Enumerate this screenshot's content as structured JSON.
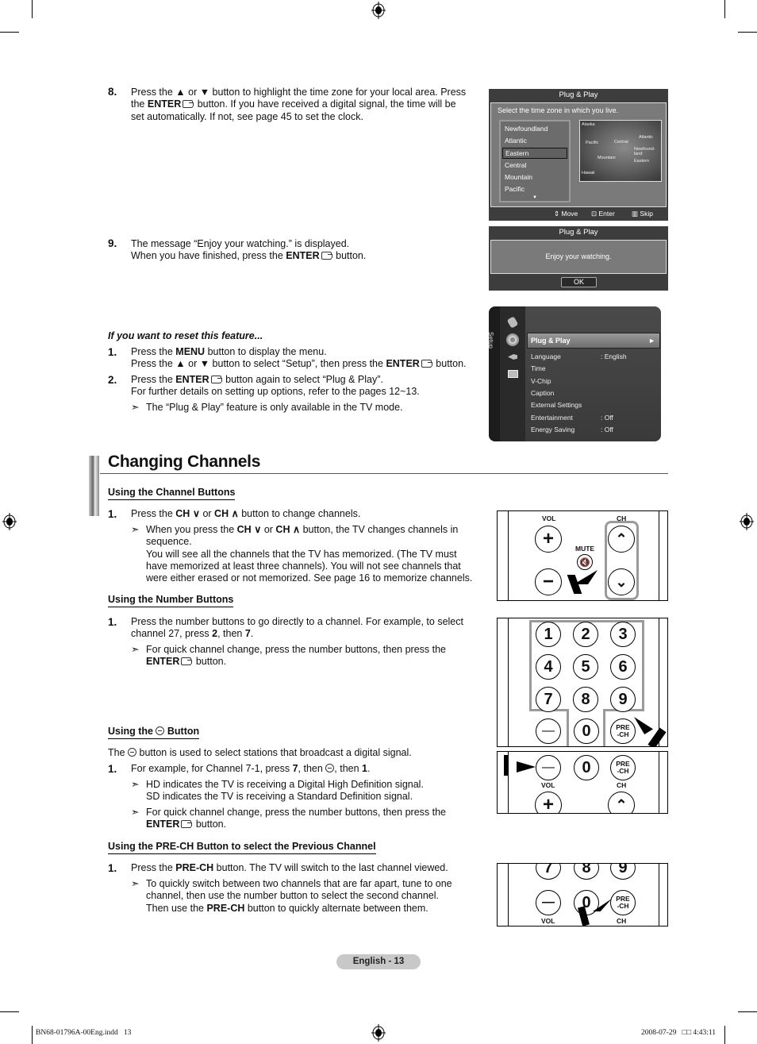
{
  "steps_top": {
    "s8": {
      "num": "8.",
      "line1": "Press the ▲ or ▼ button to highlight the time zone for your local area. Press",
      "line2a": "the ",
      "line2b": "ENTER",
      "line2c": " button. If you have received a digital signal, the time will be",
      "line3": "set automatically. If not, see page 45 to set the clock."
    },
    "s9": {
      "num": "9.",
      "line1": "The message “Enjoy your watching.” is displayed.",
      "line2a": "When you have finished, press the ",
      "line2b": "ENTER",
      "line2c": " button."
    }
  },
  "reset": {
    "heading": "If you want to reset this feature...",
    "s1": {
      "num": "1.",
      "l1a": "Press the ",
      "l1b": "MENU",
      "l1c": " button to display the menu.",
      "l2a": "Press the ▲ or ▼ button to select “Setup”, then press the ",
      "l2b": "ENTER",
      "l2c": " button."
    },
    "s2": {
      "num": "2.",
      "l1a": "Press the ",
      "l1b": "ENTER",
      "l1c": " button again to select “Plug & Play”.",
      "l2": "For further details on setting up options, refer to the pages 12~13."
    },
    "note": "The “Plug & Play” feature is only available in the TV mode."
  },
  "osd_timezone": {
    "title": "Plug & Play",
    "prompt": "Select the time zone in which you live.",
    "zones": [
      "Newfoundland",
      "Atlantic",
      "Eastern",
      "Central",
      "Mountain",
      "Pacific"
    ],
    "selected": "Eastern",
    "map_labels": [
      "Alaska",
      "Pacific",
      "Central",
      "Atlantic",
      "Newfound-land",
      "Mountain",
      "Eastern",
      "Hawaii"
    ],
    "footer": {
      "move": "Move",
      "enter": "Enter",
      "skip": "Skip"
    }
  },
  "osd_enjoy": {
    "title": "Plug & Play",
    "message": "Enjoy your watching.",
    "ok": "OK"
  },
  "osd_setup": {
    "side_label": "Setup",
    "selected": "Plug & Play",
    "items": [
      {
        "label": "Language",
        "value": ": English"
      },
      {
        "label": "Time",
        "value": ""
      },
      {
        "label": "V-Chip",
        "value": ""
      },
      {
        "label": "Caption",
        "value": ""
      },
      {
        "label": "External Settings",
        "value": ""
      },
      {
        "label": "Entertainment",
        "value": ": Off"
      },
      {
        "label": "Energy Saving",
        "value": ": Off"
      }
    ]
  },
  "section": {
    "title": "Changing Channels",
    "channel_buttons": {
      "heading": "Using the Channel Buttons",
      "s1": {
        "num": "1.",
        "a": "Press the ",
        "b": "CH",
        "c": " or ",
        "d": "CH",
        "e": " button to change channels."
      },
      "note_a": "When you press the ",
      "note_b": "CH",
      "note_c": " or ",
      "note_d": "CH",
      "note_e": " button, the TV changes channels in",
      "note_l2": "sequence.",
      "note_l3": "You will see all the channels that the TV has memorized. (The TV must",
      "note_l4": "have memorized at least three channels). You will not see channels that",
      "note_l5": "were either erased or not memorized. See page 16 to memorize channels."
    },
    "number_buttons": {
      "heading": "Using the Number Buttons",
      "s1": {
        "num": "1.",
        "l1": "Press the number buttons to go directly to a channel. For example, to select",
        "l2a": "channel 27, press ",
        "l2b": "2",
        "l2c": ", then ",
        "l2d": "7",
        "l2e": "."
      },
      "note_l1": "For quick channel change, press the number buttons, then press the",
      "note_l2a": "ENTER",
      "note_l2b": " button."
    },
    "dash_button": {
      "heading_a": "Using the ",
      "heading_b": " Button",
      "intro_a": "The ",
      "intro_b": " button is used to select stations that broadcast a digital signal.",
      "s1": {
        "num": "1.",
        "a": "For example, for Channel 7-1, press ",
        "b": "7",
        "c": ", then ",
        "d": ", then ",
        "e": "1",
        "f": "."
      },
      "note1_l1": "HD indicates the TV is receiving a Digital High Definition signal.",
      "note1_l2": "SD indicates the TV is receiving a Standard Definition signal.",
      "note2_l1": "For quick channel change, press the number buttons, then press the",
      "note2_l2a": "ENTER",
      "note2_l2b": " button."
    },
    "prech": {
      "heading": "Using the PRE-CH Button to select the Previous Channel",
      "s1": {
        "num": "1.",
        "a": "Press the ",
        "b": "PRE-CH",
        "c": " button. The TV will switch to the last channel viewed."
      },
      "note_l1": "To quickly switch between two channels that are far apart, tune to one",
      "note_l2": "channel, then use the number button to select the second channel.",
      "note_l3a": "Then use the ",
      "note_l3b": "PRE-CH",
      "note_l3c": " button to quickly alternate between them."
    }
  },
  "remote": {
    "vol": "VOL",
    "ch": "CH",
    "mute": "MUTE",
    "digits": [
      "1",
      "2",
      "3",
      "4",
      "5",
      "6",
      "7",
      "8",
      "9",
      "0"
    ],
    "prech_top": "PRE",
    "prech_bot": "-CH"
  },
  "note_arrow": "➣",
  "page_label": "English - 13",
  "slug": {
    "file": "BN68-01796A-00Eng.indd   13",
    "date": "2008-07-29   □□ 4:43:11"
  }
}
